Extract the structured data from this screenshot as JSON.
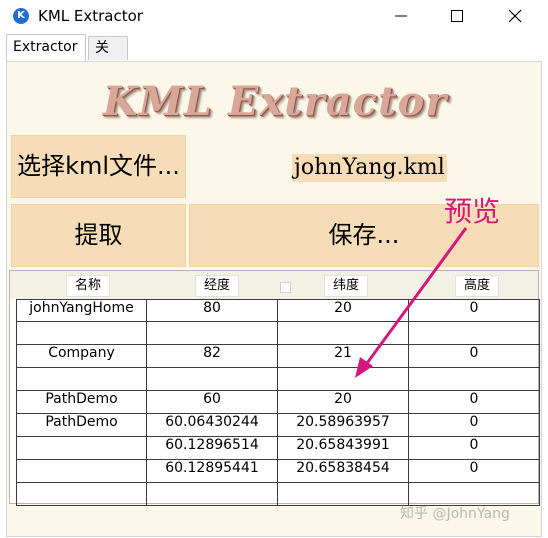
{
  "window": {
    "icon_letter": "K",
    "title": "KML Extractor"
  },
  "tabs": [
    {
      "label": "Extractor",
      "active": true
    },
    {
      "label": "关于",
      "active": false
    }
  ],
  "logo_text": "KML Extractor",
  "buttons": {
    "choose_file": "选择kml文件...",
    "extract": "提取",
    "save": "保存..."
  },
  "selected_file": "johnYang.kml",
  "annotation": {
    "label": "预览",
    "color": "#d4177a"
  },
  "grid": {
    "columns": [
      "名称",
      "经度",
      "纬度",
      "高度"
    ],
    "rows": [
      [
        "johnYangHome",
        "80",
        "20",
        "0"
      ],
      [
        "",
        "",
        "",
        ""
      ],
      [
        "Company",
        "82",
        "21",
        "0"
      ],
      [
        "",
        "",
        "",
        ""
      ],
      [
        "PathDemo",
        "60",
        "20",
        "0"
      ],
      [
        "PathDemo",
        "60.06430244",
        "20.58963957",
        "0"
      ],
      [
        "",
        "60.12896514",
        "20.65843991",
        "0"
      ],
      [
        "",
        "60.12895441",
        "20.65838454",
        "0"
      ],
      [
        "",
        "",
        "",
        ""
      ]
    ]
  },
  "colors": {
    "button_bg": "#f6ddb8",
    "panel_bg": "#fbf8e9",
    "logo": "#d9a79a"
  },
  "watermark": "知乎 @JohnYang"
}
